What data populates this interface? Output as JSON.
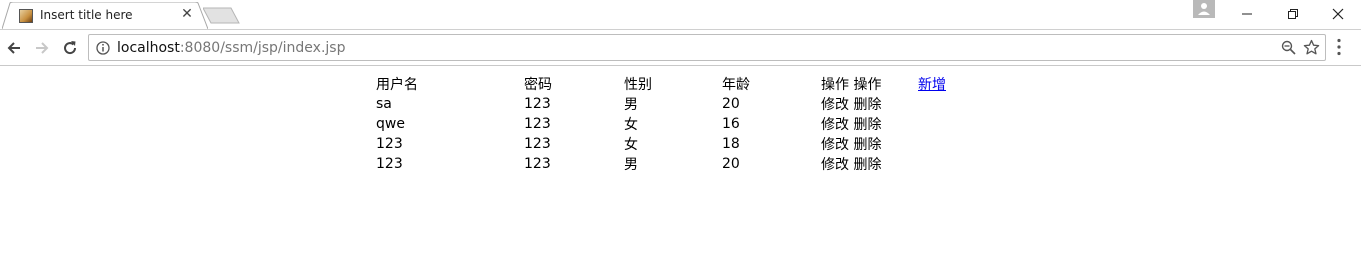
{
  "browser": {
    "tab_title": "Insert title here",
    "url_host": "localhost",
    "url_path": ":8080/ssm/jsp/index.jsp"
  },
  "table": {
    "headers": {
      "username": "用户名",
      "password": "密码",
      "gender": "性别",
      "age": "年龄",
      "ops": "操作 操作",
      "add": "新增"
    },
    "rows": [
      {
        "username": "sa",
        "password": "123",
        "gender": "男",
        "age": "20",
        "edit": "修改",
        "delete": "删除"
      },
      {
        "username": "qwe",
        "password": "123",
        "gender": "女",
        "age": "16",
        "edit": "修改",
        "delete": "删除"
      },
      {
        "username": "123",
        "password": "123",
        "gender": "女",
        "age": "18",
        "edit": "修改",
        "delete": "删除"
      },
      {
        "username": "123",
        "password": "123",
        "gender": "男",
        "age": "20",
        "edit": "修改",
        "delete": "删除"
      }
    ]
  },
  "icons": {
    "back": "arrow-left-icon",
    "forward": "arrow-right-icon",
    "reload": "reload-icon",
    "info": "info-icon",
    "zoom": "zoom-out-icon",
    "bookmark": "star-icon",
    "menu": "kebab-menu-icon",
    "profile": "person-icon",
    "minimize": "minimize-icon",
    "restore": "restore-icon",
    "close": "close-icon"
  },
  "colors": {
    "link": "#0000ee",
    "chrome_border": "#c9c9c9"
  }
}
